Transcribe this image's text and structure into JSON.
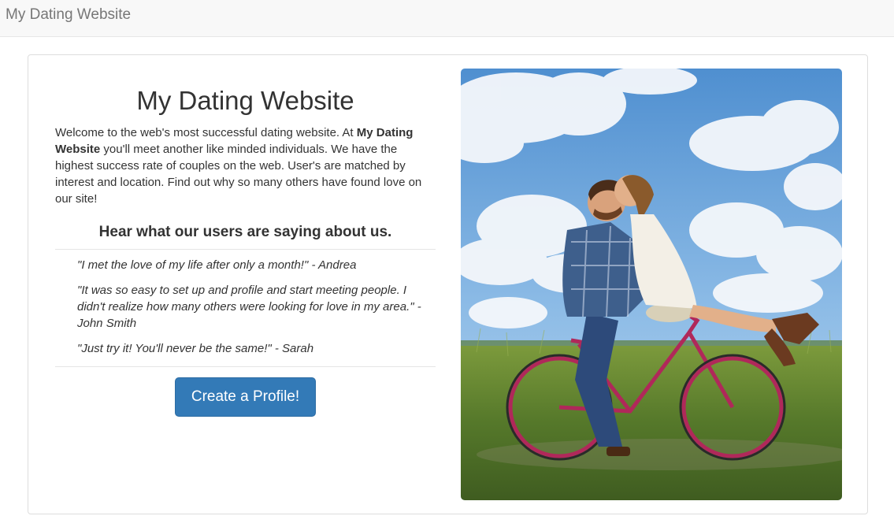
{
  "navbar": {
    "brand": "My Dating Website"
  },
  "main": {
    "title": "My Dating Website",
    "intro": {
      "part1": "Welcome to the web's most successful dating website. At ",
      "bold": "My Dating Website",
      "part2": " you'll meet another like minded individuals. We have the highest success rate of couples on the web. User's are matched by interest and location. Find out why so many others have found love on our site!"
    },
    "testimonials_heading": "Hear what our users are saying about us.",
    "testimonials": [
      "\"I met the love of my life after only a month!\" - Andrea",
      "\"It was so easy to set up and profile and start meeting people. I didn't realize how many others were looking for love in my area.\" -John Smith",
      "\"Just try it! You'll never be the same!\" - Sarah"
    ],
    "cta_label": "Create a Profile!"
  },
  "photo": {
    "subject": "couple-on-bicycle-photo"
  },
  "colors": {
    "primary": "#337ab7",
    "navbar_bg": "#f8f8f8",
    "brand_text": "#777777"
  }
}
